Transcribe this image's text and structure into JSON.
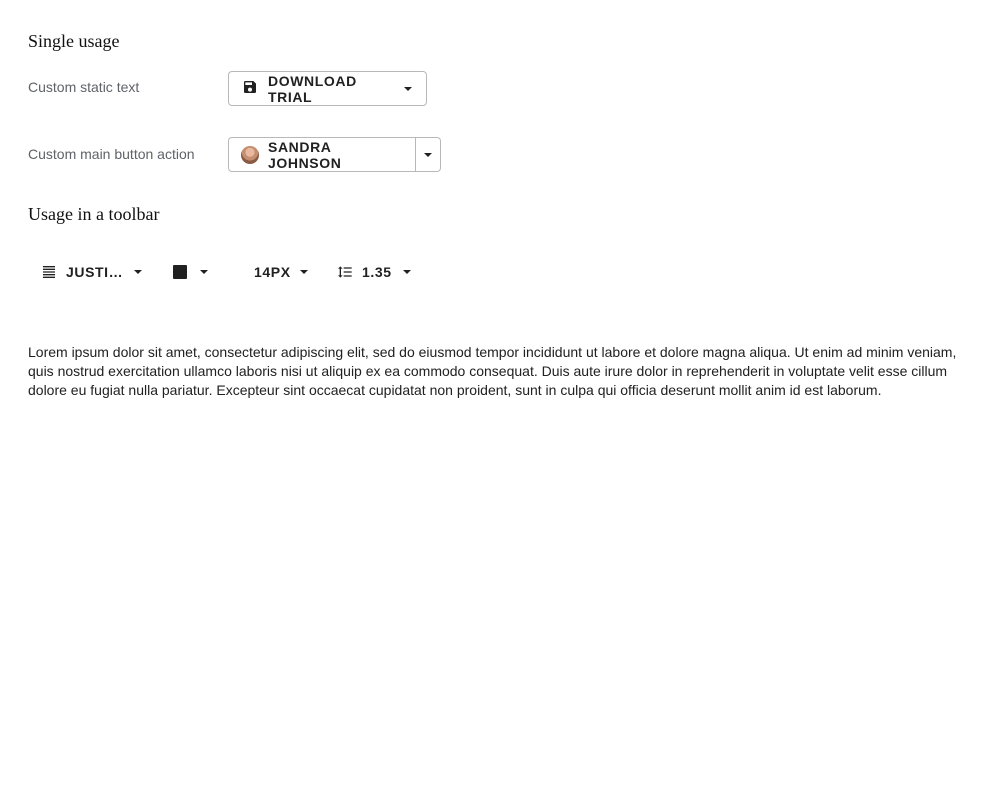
{
  "sections": {
    "single_usage_title": "Single usage",
    "toolbar_usage_title": "Usage in a toolbar"
  },
  "single_usage": {
    "row1": {
      "label": "Custom static text",
      "button_label": "DOWNLOAD TRIAL",
      "icon": "save-icon"
    },
    "row2": {
      "label": "Custom main button action",
      "button_label": "SANDRA JOHNSON",
      "icon": "avatar"
    }
  },
  "toolbar": {
    "align": {
      "label": "JUSTI…",
      "icon": "align-justify-icon"
    },
    "color": {
      "icon": "color-swatch-icon",
      "value": "#212121"
    },
    "font_size": {
      "label": "14PX"
    },
    "line_height": {
      "label": "1.35",
      "icon": "line-height-icon"
    }
  },
  "paragraph": "Lorem ipsum dolor sit amet, consectetur adipiscing elit, sed do eiusmod tempor incididunt ut labore et dolore magna aliqua. Ut enim ad minim veniam, quis nostrud exercitation ullamco laboris nisi ut aliquip ex ea commodo consequat. Duis aute irure dolor in reprehenderit in voluptate velit esse cillum dolore eu fugiat nulla pariatur. Excepteur sint occaecat cupidatat non proident, sunt in culpa qui officia deserunt mollit anim id est laborum."
}
